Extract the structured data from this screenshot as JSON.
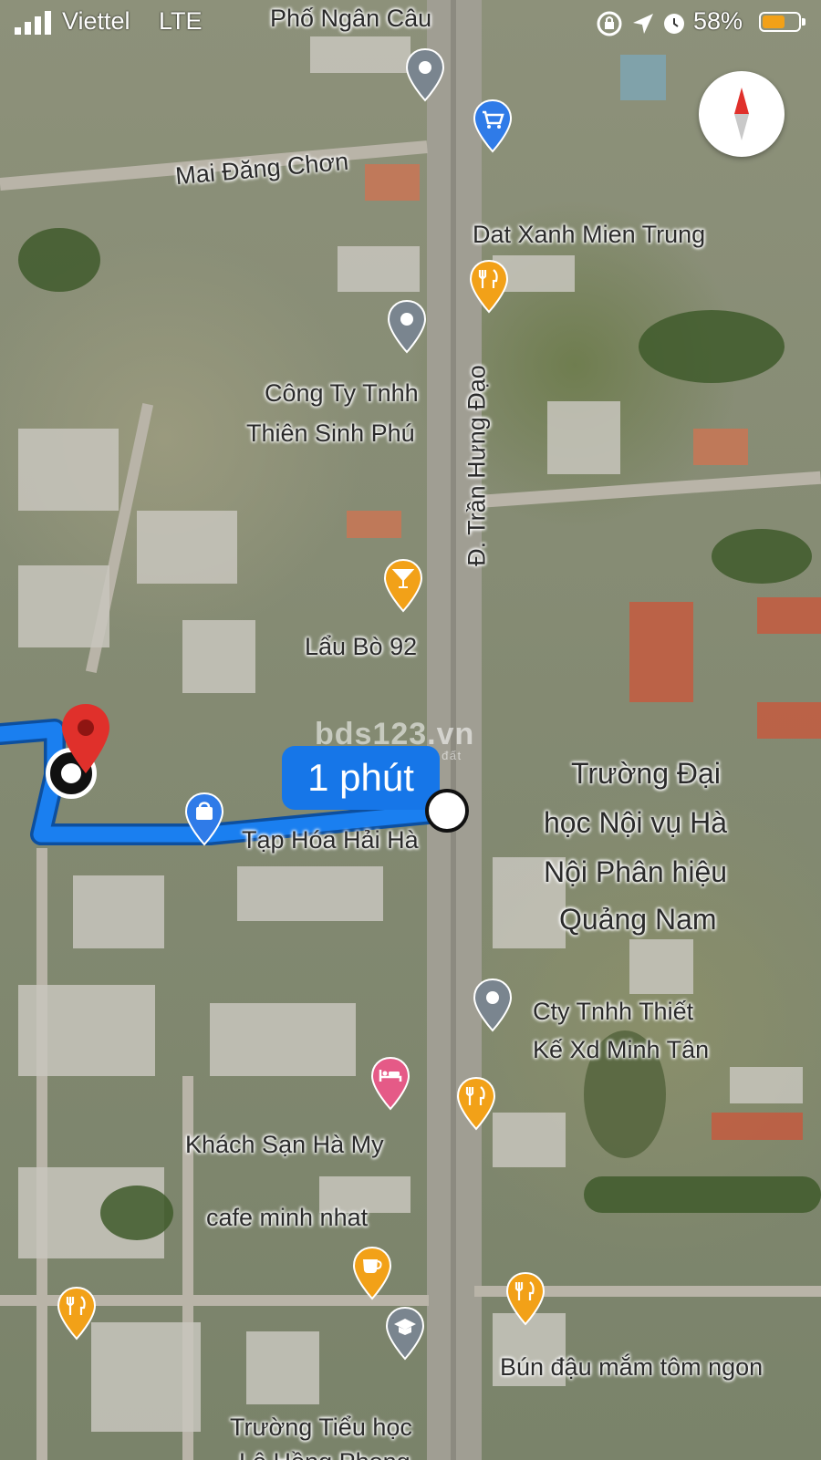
{
  "status_bar": {
    "carrier": "Viettel",
    "network": "LTE",
    "battery": "58%"
  },
  "map": {
    "street_labels": {
      "top_street": "Phố Ngân Câu",
      "mai_dang_chon": "Mai Đăng Chơn",
      "tran_hung_dao": "Đ. Trần Hưng Đạo"
    },
    "places": {
      "dat_xanh": "Dat Xanh Mien Trung",
      "thien_sinh_phu_line1": "Công Ty Tnhh",
      "thien_sinh_phu_line2": "Thiên Sinh Phú",
      "lau_bo": "Lẩu Bò 92",
      "tap_hoa": "Tạp Hóa Hải Hà",
      "university_line1": "Trường Đại",
      "university_line2": "học Nội vụ Hà",
      "university_line3": "Nội Phân hiệu",
      "university_line4": "Quảng Nam",
      "minh_tan_line1": "Cty Tnhh Thiết",
      "minh_tan_line2": "Kế Xd Minh Tân",
      "khach_san": "Khách Sạn Hà My",
      "cafe": "cafe minh nhat",
      "bun_dau": "Bún đậu mắm tôm ngon",
      "primary_school_line1": "Trường Tiểu học",
      "primary_school_line2": "Lê Hồng Phong"
    },
    "route": {
      "eta": "1 phút",
      "color": "#1a7ff0"
    },
    "watermark": {
      "title": "bds123.vn",
      "subtitle": "kênh thông tin nhà đất"
    }
  },
  "pins": {
    "generic_color": "#7a858f",
    "shopping_color": "#2f7be8",
    "food_color": "#f2a118",
    "hotel_color": "#e55a87",
    "destination_color": "#e0302b"
  }
}
